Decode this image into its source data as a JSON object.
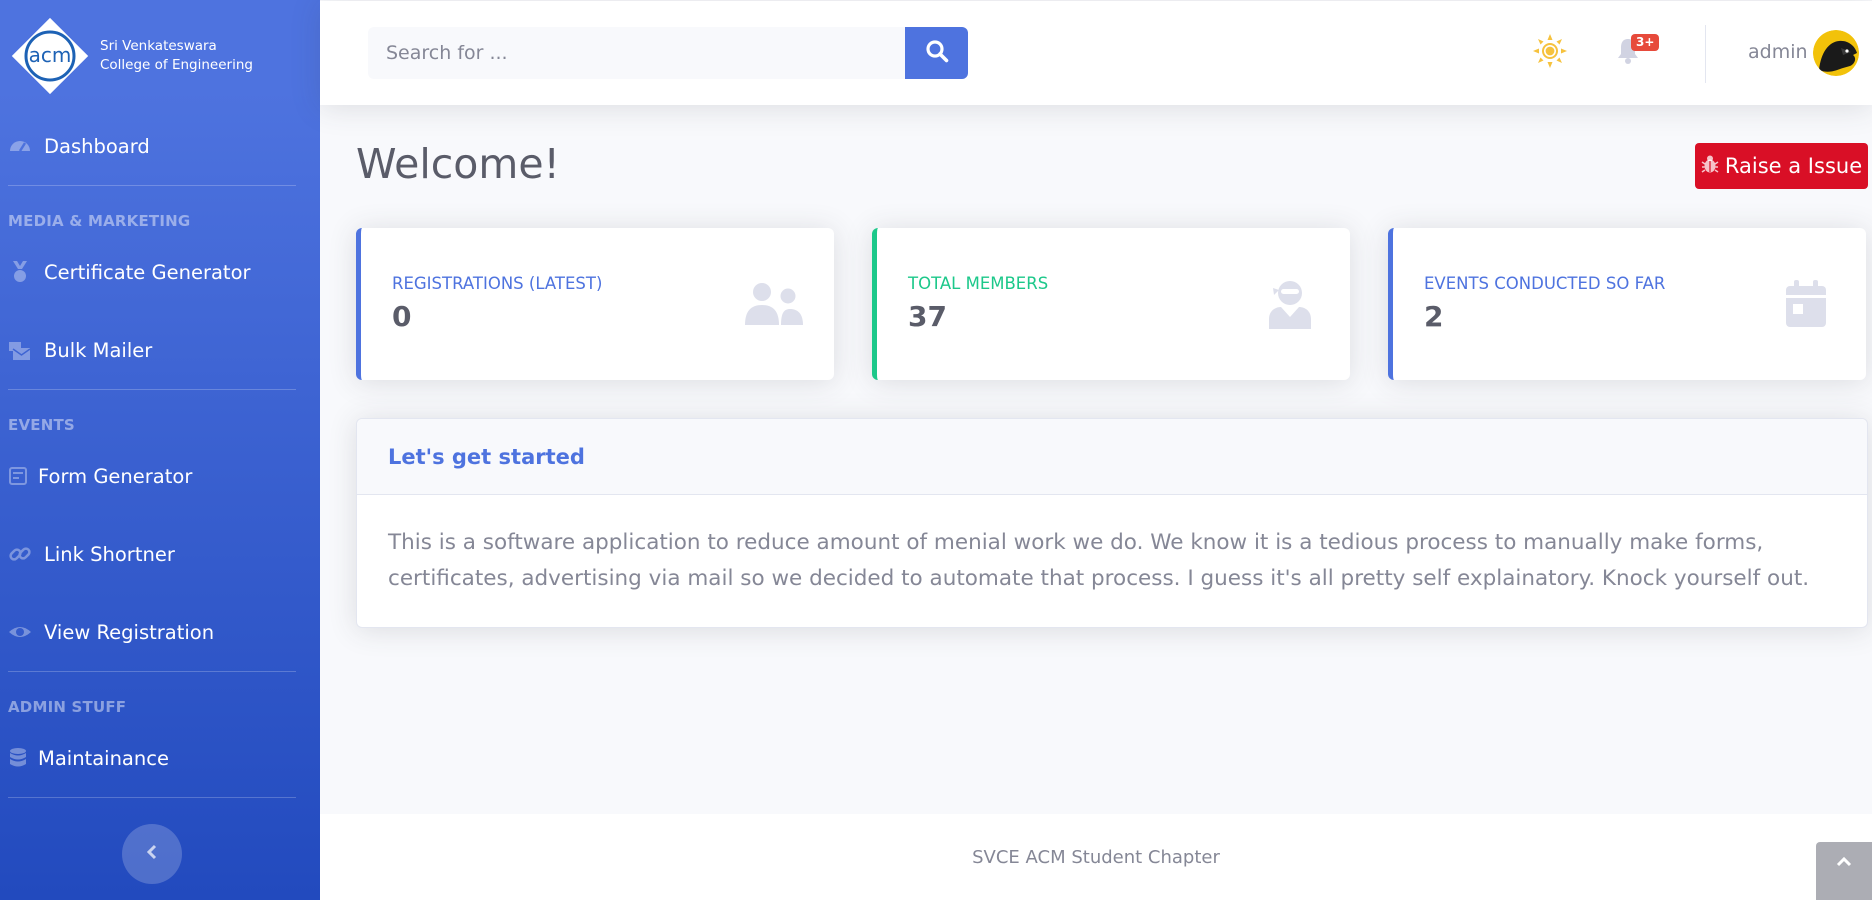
{
  "brand": {
    "logo_text": "acm",
    "line1": "Sri Venkateswara",
    "line2": "College of Engineering"
  },
  "sidebar": {
    "dashboard": "Dashboard",
    "headings": [
      "MEDIA & MARKETING",
      "EVENTS",
      "ADMIN STUFF"
    ],
    "items": [
      {
        "label": "Certificate Generator",
        "icon": "medal-icon"
      },
      {
        "label": "Bulk Mailer",
        "icon": "mail-bulk-icon"
      },
      {
        "label": "Form Generator",
        "icon": "form-icon"
      },
      {
        "label": "Link Shortner",
        "icon": "link-icon"
      },
      {
        "label": "View Registration",
        "icon": "eye-icon"
      },
      {
        "label": "Maintainance",
        "icon": "database-icon"
      }
    ]
  },
  "topbar": {
    "search_placeholder": "Search for ...",
    "notification_badge": "3+",
    "user_name": "admin"
  },
  "main": {
    "title": "Welcome!",
    "issue_button": "Raise a Issue",
    "cards": [
      {
        "label": "Registrations (Latest)",
        "value": "0",
        "icon": "users-icon"
      },
      {
        "label": "Total Members",
        "value": "37",
        "icon": "user-ninja-icon"
      },
      {
        "label": "Events Conducted So Far",
        "value": "2",
        "icon": "calendar-icon"
      }
    ],
    "intro": {
      "title": "Let's get started",
      "body": "This is a software application to reduce amount of menial work we do. We know it is a tedious process to manually make forms, certificates, advertising via mail so we decided to automate that process. I guess it's all pretty self explainatory. Knock yourself out."
    }
  },
  "footer": {
    "text": "SVCE ACM Student Chapter"
  },
  "colors": {
    "primary": "#4e73df",
    "success": "#1cc88a",
    "danger": "#d90f26",
    "badge": "#e74a3b",
    "sun": "#f6c23e"
  }
}
